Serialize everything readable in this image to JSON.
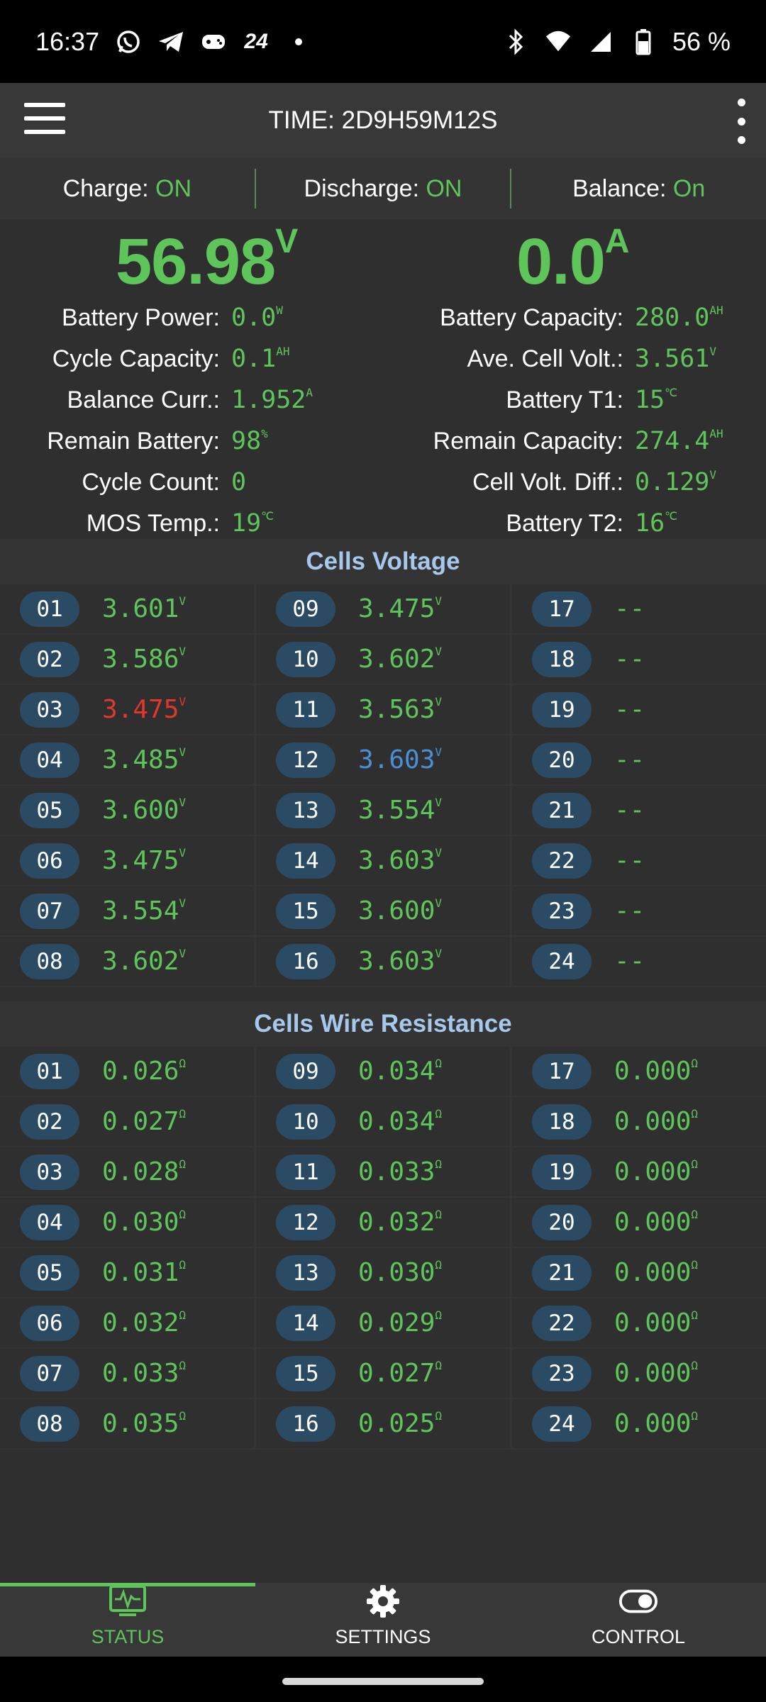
{
  "status_bar": {
    "time": "16:37",
    "battery": "56 %",
    "notif_24": "24"
  },
  "app_bar": {
    "title": "TIME: 2D9H59M12S"
  },
  "modes": [
    {
      "label": "Charge:",
      "value": "ON"
    },
    {
      "label": "Discharge:",
      "value": "ON"
    },
    {
      "label": "Balance:",
      "value": "On"
    }
  ],
  "summary": {
    "voltage": {
      "value": "56.98",
      "unit": "V"
    },
    "current": {
      "value": "0.0",
      "unit": "A"
    },
    "left": [
      {
        "label": "Battery Power:",
        "value": "0.0",
        "unit": "W"
      },
      {
        "label": "Cycle Capacity:",
        "value": "0.1",
        "unit": "AH"
      },
      {
        "label": "Balance Curr.:",
        "value": "1.952",
        "unit": "A"
      },
      {
        "label": "Remain Battery:",
        "value": "98",
        "unit": "%"
      },
      {
        "label": "Cycle Count:",
        "value": "0",
        "unit": ""
      },
      {
        "label": "MOS Temp.:",
        "value": "19",
        "unit": "℃"
      }
    ],
    "right": [
      {
        "label": "Battery Capacity:",
        "value": "280.0",
        "unit": "AH"
      },
      {
        "label": "Ave. Cell Volt.:",
        "value": "3.561",
        "unit": "V"
      },
      {
        "label": "Battery T1:",
        "value": "15",
        "unit": "℃"
      },
      {
        "label": "Remain Capacity:",
        "value": "274.4",
        "unit": "AH"
      },
      {
        "label": "Cell Volt. Diff.:",
        "value": "0.129",
        "unit": "V"
      },
      {
        "label": "Battery T2:",
        "value": "16",
        "unit": "℃"
      }
    ]
  },
  "cells_voltage": {
    "title": "Cells Voltage",
    "colors": {
      "normal": "#5ec55a",
      "min": "#e0382f",
      "max": "#4a90d9"
    },
    "cells": [
      {
        "id": "01",
        "value": "3.601",
        "unit": "V",
        "state": "normal"
      },
      {
        "id": "02",
        "value": "3.586",
        "unit": "V",
        "state": "normal"
      },
      {
        "id": "03",
        "value": "3.475",
        "unit": "V",
        "state": "min"
      },
      {
        "id": "04",
        "value": "3.485",
        "unit": "V",
        "state": "normal"
      },
      {
        "id": "05",
        "value": "3.600",
        "unit": "V",
        "state": "normal"
      },
      {
        "id": "06",
        "value": "3.475",
        "unit": "V",
        "state": "normal"
      },
      {
        "id": "07",
        "value": "3.554",
        "unit": "V",
        "state": "normal"
      },
      {
        "id": "08",
        "value": "3.602",
        "unit": "V",
        "state": "normal"
      },
      {
        "id": "09",
        "value": "3.475",
        "unit": "V",
        "state": "normal"
      },
      {
        "id": "10",
        "value": "3.602",
        "unit": "V",
        "state": "normal"
      },
      {
        "id": "11",
        "value": "3.563",
        "unit": "V",
        "state": "normal"
      },
      {
        "id": "12",
        "value": "3.603",
        "unit": "V",
        "state": "max"
      },
      {
        "id": "13",
        "value": "3.554",
        "unit": "V",
        "state": "normal"
      },
      {
        "id": "14",
        "value": "3.603",
        "unit": "V",
        "state": "normal"
      },
      {
        "id": "15",
        "value": "3.600",
        "unit": "V",
        "state": "normal"
      },
      {
        "id": "16",
        "value": "3.603",
        "unit": "V",
        "state": "normal"
      },
      {
        "id": "17",
        "value": "--",
        "unit": "",
        "state": "normal"
      },
      {
        "id": "18",
        "value": "--",
        "unit": "",
        "state": "normal"
      },
      {
        "id": "19",
        "value": "--",
        "unit": "",
        "state": "normal"
      },
      {
        "id": "20",
        "value": "--",
        "unit": "",
        "state": "normal"
      },
      {
        "id": "21",
        "value": "--",
        "unit": "",
        "state": "normal"
      },
      {
        "id": "22",
        "value": "--",
        "unit": "",
        "state": "normal"
      },
      {
        "id": "23",
        "value": "--",
        "unit": "",
        "state": "normal"
      },
      {
        "id": "24",
        "value": "--",
        "unit": "",
        "state": "normal"
      }
    ]
  },
  "cells_resistance": {
    "title": "Cells Wire Resistance",
    "cells": [
      {
        "id": "01",
        "value": "0.026",
        "unit": "Ω"
      },
      {
        "id": "02",
        "value": "0.027",
        "unit": "Ω"
      },
      {
        "id": "03",
        "value": "0.028",
        "unit": "Ω"
      },
      {
        "id": "04",
        "value": "0.030",
        "unit": "Ω"
      },
      {
        "id": "05",
        "value": "0.031",
        "unit": "Ω"
      },
      {
        "id": "06",
        "value": "0.032",
        "unit": "Ω"
      },
      {
        "id": "07",
        "value": "0.033",
        "unit": "Ω"
      },
      {
        "id": "08",
        "value": "0.035",
        "unit": "Ω"
      },
      {
        "id": "09",
        "value": "0.034",
        "unit": "Ω"
      },
      {
        "id": "10",
        "value": "0.034",
        "unit": "Ω"
      },
      {
        "id": "11",
        "value": "0.033",
        "unit": "Ω"
      },
      {
        "id": "12",
        "value": "0.032",
        "unit": "Ω"
      },
      {
        "id": "13",
        "value": "0.030",
        "unit": "Ω"
      },
      {
        "id": "14",
        "value": "0.029",
        "unit": "Ω"
      },
      {
        "id": "15",
        "value": "0.027",
        "unit": "Ω"
      },
      {
        "id": "16",
        "value": "0.025",
        "unit": "Ω"
      },
      {
        "id": "17",
        "value": "0.000",
        "unit": "Ω"
      },
      {
        "id": "18",
        "value": "0.000",
        "unit": "Ω"
      },
      {
        "id": "19",
        "value": "0.000",
        "unit": "Ω"
      },
      {
        "id": "20",
        "value": "0.000",
        "unit": "Ω"
      },
      {
        "id": "21",
        "value": "0.000",
        "unit": "Ω"
      },
      {
        "id": "22",
        "value": "0.000",
        "unit": "Ω"
      },
      {
        "id": "23",
        "value": "0.000",
        "unit": "Ω"
      },
      {
        "id": "24",
        "value": "0.000",
        "unit": "Ω"
      }
    ]
  },
  "nav": [
    {
      "label": "STATUS",
      "icon": "status-monitor-icon",
      "active": true
    },
    {
      "label": "SETTINGS",
      "icon": "gear-icon",
      "active": false
    },
    {
      "label": "CONTROL",
      "icon": "toggle-icon",
      "active": false
    }
  ]
}
